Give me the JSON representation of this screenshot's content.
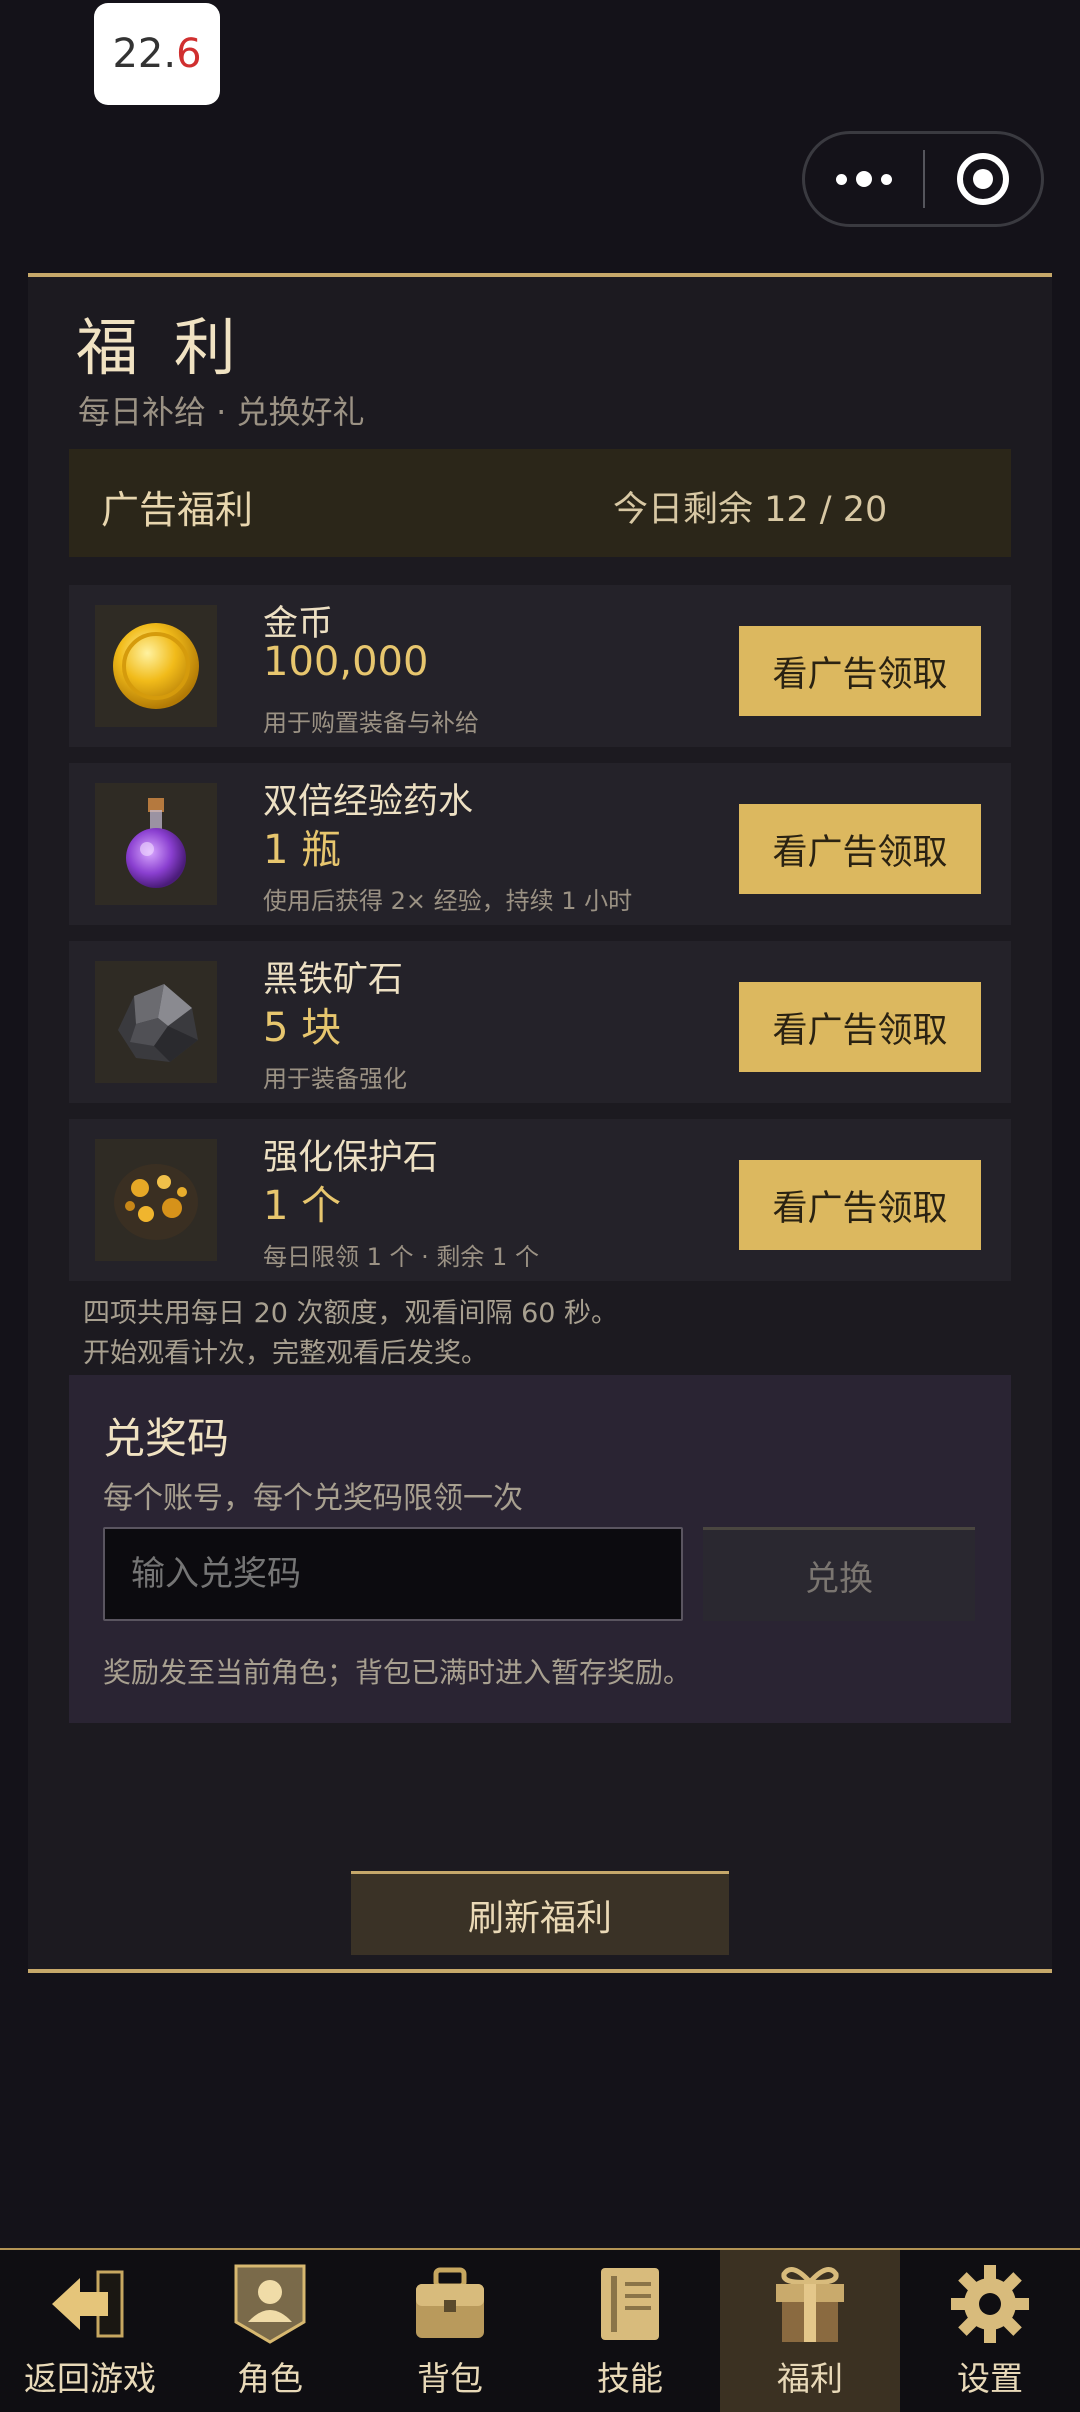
{
  "status": {
    "fps_main": "22.",
    "fps_decimal": "6"
  },
  "panel": {
    "title": "福 利",
    "subtitle": "每日补给 · 兑换好礼",
    "ad_header": {
      "label": "广告福利",
      "remaining": "今日剩余  12 / 20"
    },
    "items": [
      {
        "name": "金币",
        "qty": "100,000",
        "desc": "用于购置装备与补给",
        "button": "看广告领取",
        "icon": "gold-coin-icon"
      },
      {
        "name": "双倍经验药水",
        "qty": "1 瓶",
        "desc": "使用后获得 2× 经验，持续 1 小时",
        "button": "看广告领取",
        "icon": "potion-icon"
      },
      {
        "name": "黑铁矿石",
        "qty": "5 块",
        "desc": "用于装备强化",
        "button": "看广告领取",
        "icon": "iron-ore-icon"
      },
      {
        "name": "强化保护石",
        "qty": "1 个",
        "desc": "每日限领 1 个 · 剩余 1 个",
        "button": "看广告领取",
        "icon": "protect-stone-icon"
      }
    ],
    "notes": [
      "四项共用每日 20 次额度，观看间隔 60 秒。",
      "开始观看计次，完整观看后发奖。"
    ],
    "redeem": {
      "title": "兑奖码",
      "subtitle": "每个账号，每个兑奖码限领一次",
      "placeholder": "输入兑奖码",
      "button": "兑换",
      "footer": "奖励发至当前角色；背包已满时进入暂存奖励。"
    },
    "refresh": "刷新福利"
  },
  "tabs": [
    {
      "label": "返回游戏",
      "icon": "back-arrow-icon"
    },
    {
      "label": "角色",
      "icon": "character-icon"
    },
    {
      "label": "背包",
      "icon": "bag-icon"
    },
    {
      "label": "技能",
      "icon": "skill-book-icon"
    },
    {
      "label": "福利",
      "icon": "gift-icon",
      "active": true
    },
    {
      "label": "设置",
      "icon": "gear-icon"
    }
  ],
  "colors": {
    "accent_gold": "#dcb85f",
    "border_gold": "#c6a86a",
    "background": "#141219"
  }
}
